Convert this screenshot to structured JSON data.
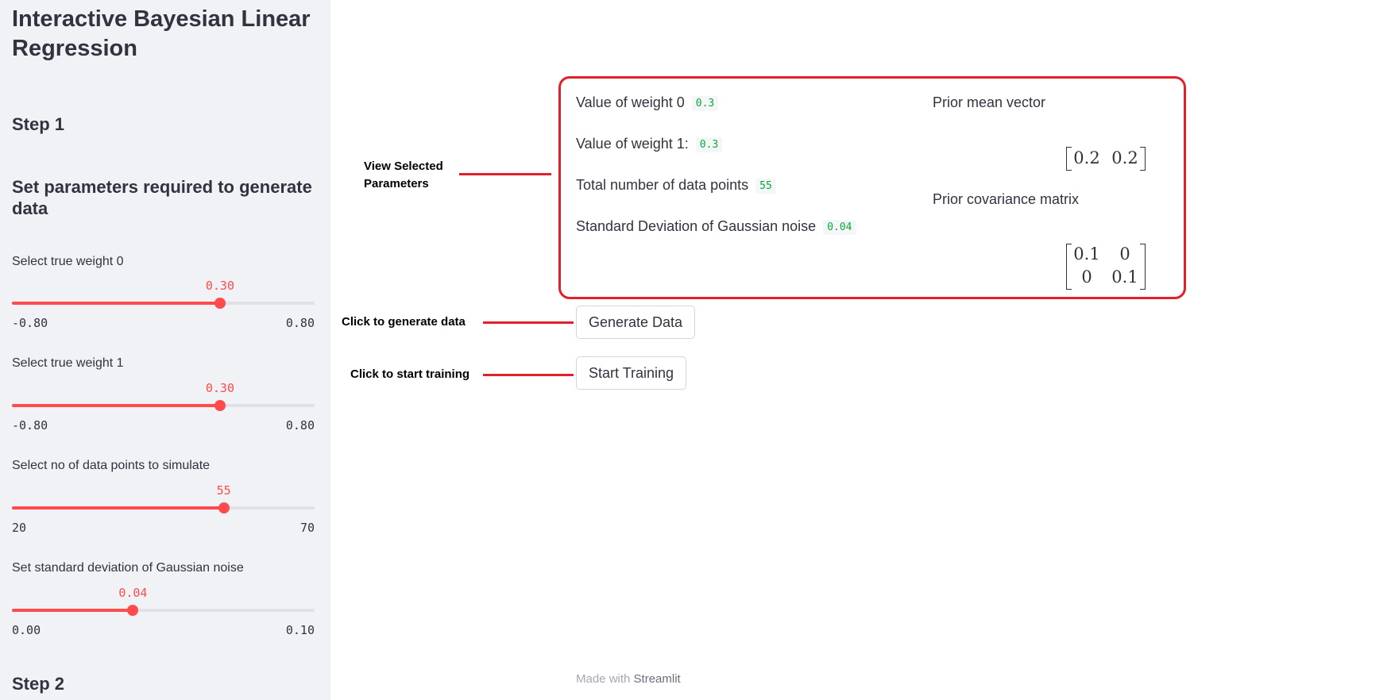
{
  "sidebar": {
    "title": "Interactive Bayesian Linear Regression",
    "step1": "Step 1",
    "section_heading": "Set parameters required to generate data",
    "sliders": [
      {
        "label": "Select true weight 0",
        "value": "0.30",
        "min": "-0.80",
        "max": "0.80",
        "fraction": 0.6875
      },
      {
        "label": "Select true weight 1",
        "value": "0.30",
        "min": "-0.80",
        "max": "0.80",
        "fraction": 0.6875
      },
      {
        "label": "Select no of data points to simulate",
        "value": "55",
        "min": "20",
        "max": "70",
        "fraction": 0.7
      },
      {
        "label": "Set standard deviation of Gaussian noise",
        "value": "0.04",
        "min": "0.00",
        "max": "0.10",
        "fraction": 0.4
      }
    ],
    "step2": "Step 2"
  },
  "annotations": {
    "view_selected": "View Selected Parameters",
    "generate": "Click to generate data",
    "training": "Click to start training"
  },
  "params": {
    "weight0_label": "Value of weight 0",
    "weight0_value": "0.3",
    "weight1_label": "Value of weight 1:",
    "weight1_value": "0.3",
    "points_label": "Total number of data points",
    "points_value": "55",
    "noise_label": "Standard Deviation of Gaussian noise",
    "noise_value": "0.04",
    "prior_mean_label": "Prior mean vector",
    "prior_mean": [
      "0.2",
      "0.2"
    ],
    "prior_cov_label": "Prior covariance matrix",
    "prior_cov": [
      [
        "0.1",
        "0"
      ],
      [
        "0",
        "0.1"
      ]
    ]
  },
  "buttons": {
    "generate": "Generate Data",
    "train": "Start Training"
  },
  "footer": {
    "made_with": "Made with",
    "brand": "Streamlit"
  },
  "colors": {
    "accent": "#ff4b4b",
    "annotation": "#e0202a",
    "code_text": "#09ab3b"
  }
}
